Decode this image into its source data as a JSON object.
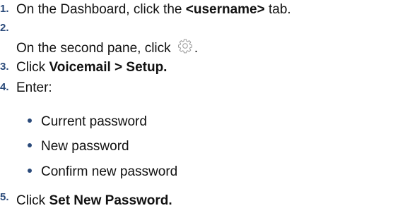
{
  "steps": [
    {
      "number": "1.",
      "prefix": "On the Dashboard, click the ",
      "bold": "<username>",
      "suffix": " tab."
    },
    {
      "number": "2.",
      "prefix": "On the second pane, click ",
      "icon": "gear-icon",
      "suffix": "."
    },
    {
      "number": "3.",
      "prefix": "Click ",
      "bold": "Voicemail > Setup."
    },
    {
      "number": "4.",
      "prefix": "Enter:",
      "bullets": [
        "Current password",
        "New password",
        "Confirm new password"
      ]
    },
    {
      "number": "5.",
      "prefix": "Click ",
      "bold": "Set New Password."
    }
  ],
  "colors": {
    "number": "#2a4a7a",
    "text": "#111111",
    "icon_stroke": "#9a9a9a"
  }
}
